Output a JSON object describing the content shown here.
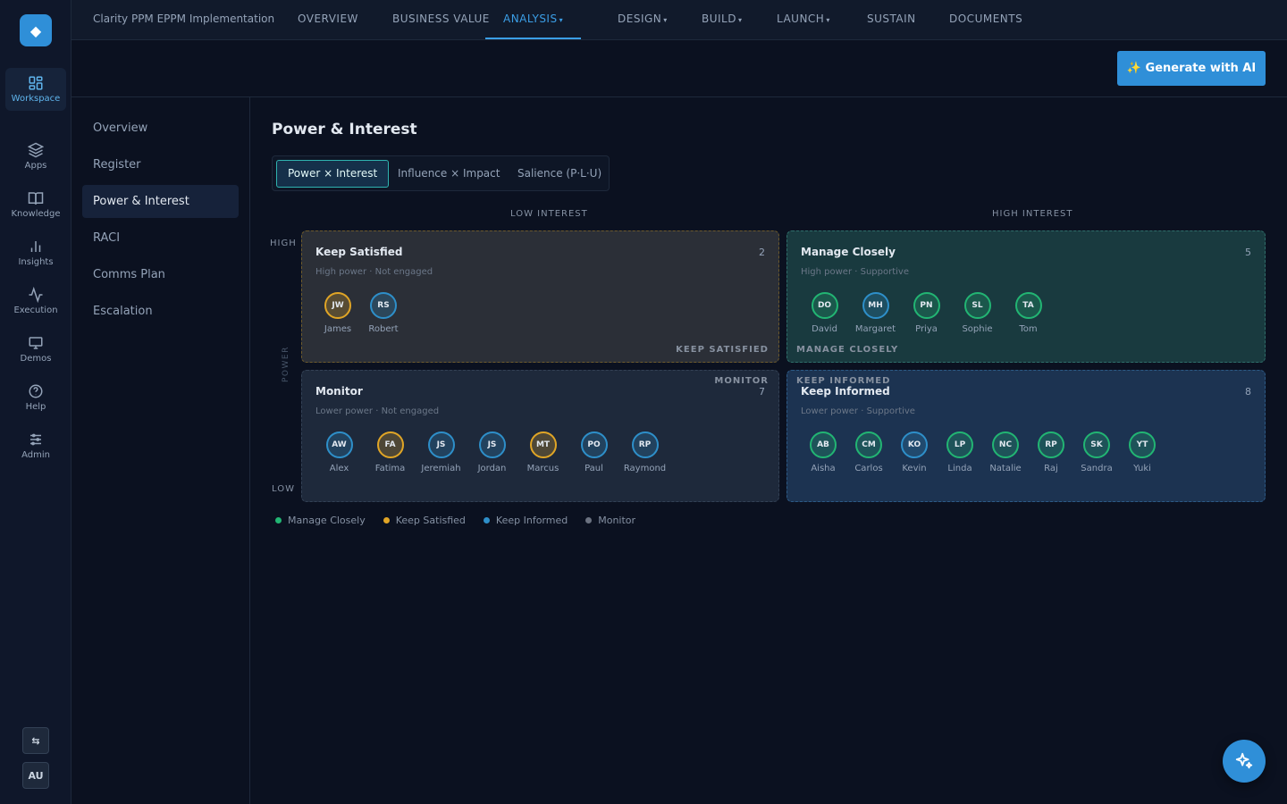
{
  "rail": {
    "items": [
      {
        "label": "Workspace",
        "icon": "grid-icon"
      },
      {
        "label": "Apps",
        "icon": "layers-icon"
      },
      {
        "label": "Knowledge",
        "icon": "book-icon"
      },
      {
        "label": "Insights",
        "icon": "bar-chart-icon"
      },
      {
        "label": "Execution",
        "icon": "activity-icon"
      },
      {
        "label": "Demos",
        "icon": "monitor-icon"
      },
      {
        "label": "Help",
        "icon": "help-icon"
      },
      {
        "label": "Admin",
        "icon": "sliders-icon"
      }
    ],
    "user_initials": "AU"
  },
  "topbar": {
    "project": "Clarity PPM EPPM Implementation",
    "tabs": [
      {
        "label": "OVERVIEW"
      },
      {
        "label": "BUSINESS VALUE"
      },
      {
        "label": "ANALYSIS"
      },
      {
        "label": "DESIGN"
      },
      {
        "label": "BUILD"
      },
      {
        "label": "LAUNCH"
      },
      {
        "label": "SUSTAIN"
      },
      {
        "label": "DOCUMENTS"
      }
    ],
    "caret": "▾"
  },
  "actions": {
    "generate_label": "✨ Generate with AI"
  },
  "subnav": {
    "items": [
      "Overview",
      "Register",
      "Power & Interest",
      "RACI",
      "Comms Plan",
      "Escalation"
    ]
  },
  "main": {
    "title": "Power & Interest",
    "segments": [
      "Power × Interest",
      "Influence × Impact",
      "Salience (P·L·U)"
    ],
    "axis": {
      "low_interest": "LOW INTEREST",
      "high_interest": "HIGH INTEREST",
      "high": "HIGH",
      "low": "LOW",
      "power": "POWER"
    },
    "quadrants": {
      "keep_satisfied": {
        "title": "Keep Satisfied",
        "count": "2",
        "subtitle": "High power · Not engaged",
        "tag": "KEEP SATISFIED",
        "people": [
          {
            "initials": "JW",
            "name": "James",
            "color": "#e0a526"
          },
          {
            "initials": "RS",
            "name": "Robert",
            "color": "#2e8fc9"
          }
        ]
      },
      "manage_closely": {
        "title": "Manage Closely",
        "count": "5",
        "subtitle": "High power · Supportive",
        "tag": "MANAGE CLOSELY",
        "people": [
          {
            "initials": "DO",
            "name": "David",
            "color": "#22b573"
          },
          {
            "initials": "MH",
            "name": "Margaret",
            "color": "#2e8fc9"
          },
          {
            "initials": "PN",
            "name": "Priya",
            "color": "#22b573"
          },
          {
            "initials": "SL",
            "name": "Sophie",
            "color": "#22b573"
          },
          {
            "initials": "TA",
            "name": "Tom",
            "color": "#22b573"
          }
        ]
      },
      "monitor": {
        "title": "Monitor",
        "count": "7",
        "subtitle": "Lower power · Not engaged",
        "tag": "MONITOR",
        "people": [
          {
            "initials": "AW",
            "name": "Alex",
            "color": "#2e8fc9"
          },
          {
            "initials": "FA",
            "name": "Fatima",
            "color": "#e0a526"
          },
          {
            "initials": "JS",
            "name": "Jeremiah",
            "color": "#2e8fc9"
          },
          {
            "initials": "JS",
            "name": "Jordan",
            "color": "#2e8fc9"
          },
          {
            "initials": "MT",
            "name": "Marcus",
            "color": "#e0a526"
          },
          {
            "initials": "PO",
            "name": "Paul",
            "color": "#2e8fc9"
          },
          {
            "initials": "RP",
            "name": "Raymond",
            "color": "#2e8fc9"
          }
        ]
      },
      "keep_informed": {
        "title": "Keep Informed",
        "count": "8",
        "subtitle": "Lower power · Supportive",
        "tag": "KEEP INFORMED",
        "people": [
          {
            "initials": "AB",
            "name": "Aisha",
            "color": "#22b573"
          },
          {
            "initials": "CM",
            "name": "Carlos",
            "color": "#22b573"
          },
          {
            "initials": "KO",
            "name": "Kevin",
            "color": "#2e8fc9"
          },
          {
            "initials": "LP",
            "name": "Linda",
            "color": "#22b573"
          },
          {
            "initials": "NC",
            "name": "Natalie",
            "color": "#22b573"
          },
          {
            "initials": "RP",
            "name": "Raj",
            "color": "#22b573"
          },
          {
            "initials": "SK",
            "name": "Sandra",
            "color": "#22b573"
          },
          {
            "initials": "YT",
            "name": "Yuki",
            "color": "#22b573"
          }
        ]
      }
    },
    "legend": [
      {
        "label": "Manage Closely",
        "color": "#22b573"
      },
      {
        "label": "Keep Satisfied",
        "color": "#e0a526"
      },
      {
        "label": "Keep Informed",
        "color": "#2e8fc9"
      },
      {
        "label": "Monitor",
        "color": "#6b7280"
      }
    ]
  },
  "colors": {
    "accent": "#2f8fd8",
    "active_tab": "#3b9ee6",
    "segment_active": "#2fb3b0"
  }
}
